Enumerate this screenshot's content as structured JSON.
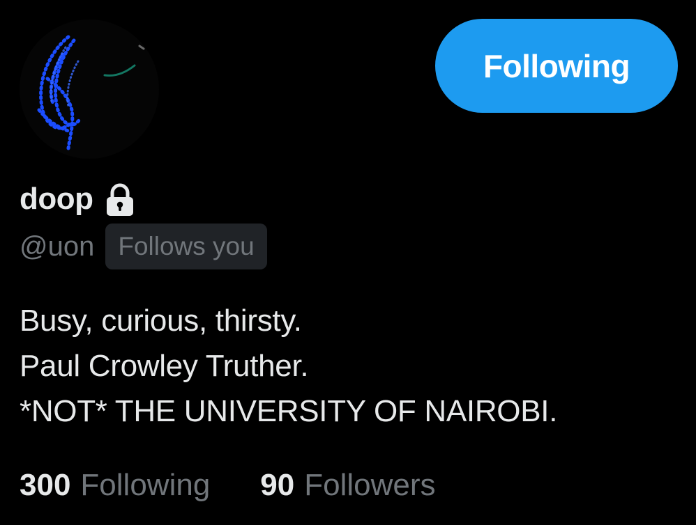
{
  "profile": {
    "display_name": "doop",
    "handle": "@uon",
    "follows_you_badge": "Follows you",
    "protected_icon": "lock-icon",
    "avatar_icon": "neon-blue-glyph-avatar",
    "bio_lines": [
      "Busy, curious, thirsty.",
      "Paul Crowley Truther.",
      "*NOT* THE UNIVERSITY OF NAIROBI."
    ]
  },
  "follow_button": {
    "label": "Following",
    "color": "#1d9bf0"
  },
  "stats": [
    {
      "count": "300",
      "label": "Following"
    },
    {
      "count": "90",
      "label": "Followers"
    }
  ],
  "colors": {
    "background": "#000000",
    "primary_text": "#e7e9ea",
    "secondary_text": "#71767b",
    "badge_background": "#202327",
    "accent": "#1d9bf0"
  }
}
